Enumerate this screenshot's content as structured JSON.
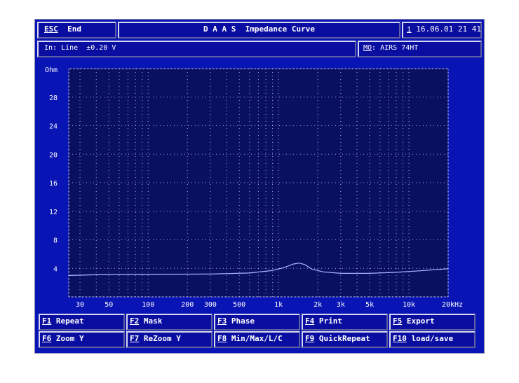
{
  "header": {
    "esc_key": "ESC",
    "esc_label": "End",
    "title": "D A A S  Impedance Curve",
    "info_key": "i",
    "datetime": "16.06.01 21 41"
  },
  "status": {
    "input": "In: Line  ±0.20 V",
    "mo_key": "MO",
    "mo_value": ": AIRS 74HT"
  },
  "function_keys": [
    {
      "key": "F1",
      "label": "Repeat"
    },
    {
      "key": "F2",
      "label": "Mask"
    },
    {
      "key": "F3",
      "label": "Phase"
    },
    {
      "key": "F4",
      "label": "Print"
    },
    {
      "key": "F5",
      "label": "Export"
    },
    {
      "key": "F6",
      "label": "Zoom Y"
    },
    {
      "key": "F7",
      "label": "ReZoom Y"
    },
    {
      "key": "F8",
      "label": "Min/Max/L/C"
    },
    {
      "key": "F9",
      "label": "QuickRepeat"
    },
    {
      "key": "F10",
      "label": "load/save"
    }
  ],
  "colors": {
    "curve": "#a8b8ff",
    "plot_bg": "#0a1060",
    "grid": "#c8c8ff"
  },
  "chart_data": {
    "type": "line",
    "title": "Impedance Curve",
    "ylabel": "Ohm",
    "xlabel": "Hz",
    "xscale": "log",
    "xlim": [
      24.6,
      20000
    ],
    "ylim": [
      0,
      32
    ],
    "yticks": [
      4,
      8,
      12,
      16,
      20,
      24,
      28
    ],
    "xticks": [
      {
        "v": 30,
        "label": "30"
      },
      {
        "v": 50,
        "label": "50"
      },
      {
        "v": 100,
        "label": "100"
      },
      {
        "v": 200,
        "label": "200"
      },
      {
        "v": 300,
        "label": "300"
      },
      {
        "v": 500,
        "label": "500"
      },
      {
        "v": 1000,
        "label": "1k"
      },
      {
        "v": 2000,
        "label": "2k"
      },
      {
        "v": 3000,
        "label": "3k"
      },
      {
        "v": 5000,
        "label": "5k"
      },
      {
        "v": 10000,
        "label": "10k"
      },
      {
        "v": 20000,
        "label": "20kHz"
      }
    ],
    "series": [
      {
        "name": "Impedance",
        "x": [
          24.6,
          40,
          100,
          300,
          600,
          900,
          1100,
          1300,
          1450,
          1600,
          1800,
          2200,
          3000,
          5000,
          8000,
          12000,
          20000
        ],
        "y": [
          3.0,
          3.1,
          3.15,
          3.2,
          3.35,
          3.7,
          4.1,
          4.6,
          4.75,
          4.5,
          3.9,
          3.5,
          3.3,
          3.3,
          3.45,
          3.65,
          3.95
        ]
      }
    ]
  }
}
